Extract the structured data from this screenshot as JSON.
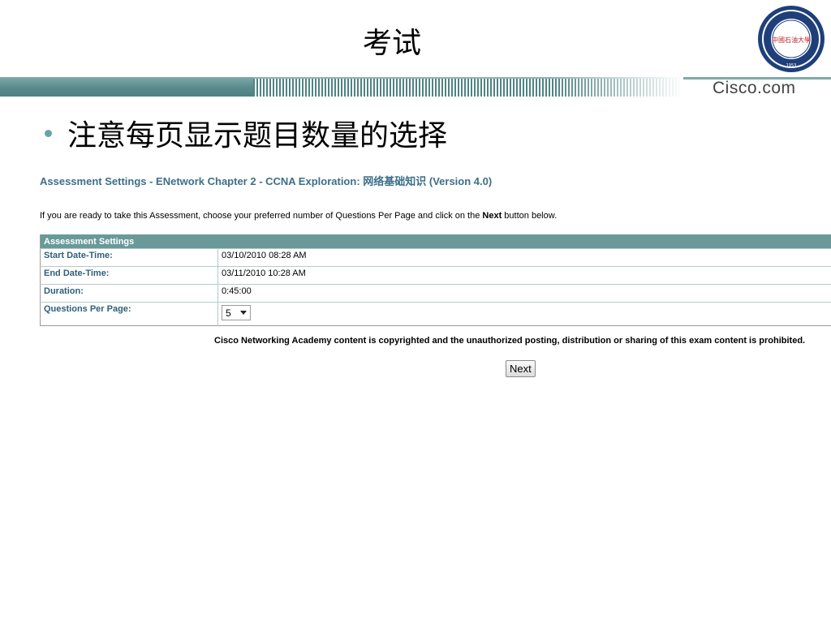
{
  "slide": {
    "title": "考试",
    "bullet": "注意每页显示题目数量的选择"
  },
  "logo": {
    "ring_text_top": "CHINA UNIVERSITY OF PETROLEUM",
    "seal_text": "中國石油大學",
    "year": "1953"
  },
  "banner": {
    "brand": "Cisco.com"
  },
  "assessment": {
    "title": "Assessment Settings - ENetwork Chapter 2 - CCNA Exploration: 网络基础知识  (Version 4.0)",
    "instruction_before": "If you are ready to take this Assessment, choose your preferred number of Questions Per Page and click on the ",
    "instruction_bold": "Next",
    "instruction_after": " button below.",
    "table_header": "Assessment Settings",
    "rows": [
      {
        "label": "Start Date-Time:",
        "value": "03/10/2010 08:28 AM"
      },
      {
        "label": "End Date-Time:",
        "value": "03/11/2010 10:28 AM"
      },
      {
        "label": "Duration:",
        "value": "0:45:00"
      }
    ],
    "qpp_label": "Questions Per Page:",
    "qpp_value": "5",
    "copyright": "Cisco Networking Academy content is copyrighted and the unauthorized posting, distribution or sharing of this exam content is prohibited.",
    "next_label": "Next"
  },
  "colors": {
    "teal": "#5b8d8e",
    "header_bg": "#6a9999",
    "label_blue": "#2f5f7a",
    "title_blue": "#3d6f88"
  }
}
